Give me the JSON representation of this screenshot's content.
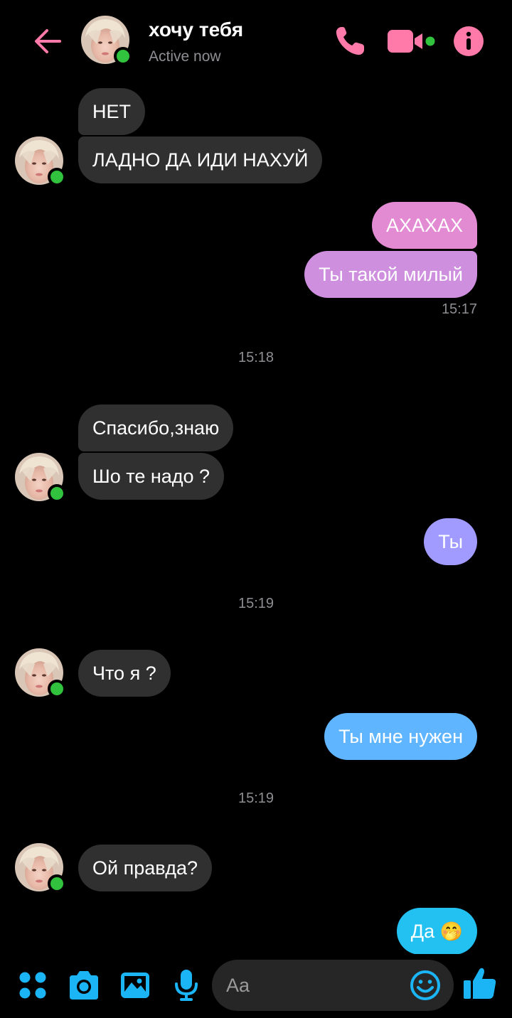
{
  "header": {
    "title": "хочу тебя",
    "status": "Active now",
    "icons": [
      "back-arrow-icon",
      "phone-icon",
      "video-camera-icon",
      "info-icon"
    ]
  },
  "colors": {
    "accent_pink": "#ff7aa8",
    "online_green": "#31c33d",
    "composer_blue": "#1bb5f6",
    "incoming_bubble": "#303030"
  },
  "messages": {
    "m1": "НЕТ",
    "m2": "ЛАДНО ДА ИДИ НАХУЙ",
    "m3": "АХАХАХ",
    "m4": "Ты такой милый",
    "t1": "15:17",
    "t2": "15:18",
    "m5": "Спасибо,знаю",
    "m6": "Шо те надо ?",
    "m7": "Ты",
    "t3": "15:19",
    "m8": "Что я ?",
    "m9": "Ты мне нужен",
    "t4": "15:19",
    "m10": "Ой правда?",
    "m11": "Да",
    "m11_emoji": "🤭"
  },
  "composer": {
    "placeholder": "Aa",
    "icons": [
      "menu-dots-icon",
      "camera-icon",
      "gallery-icon",
      "microphone-icon",
      "emoji-icon",
      "like-icon"
    ]
  }
}
